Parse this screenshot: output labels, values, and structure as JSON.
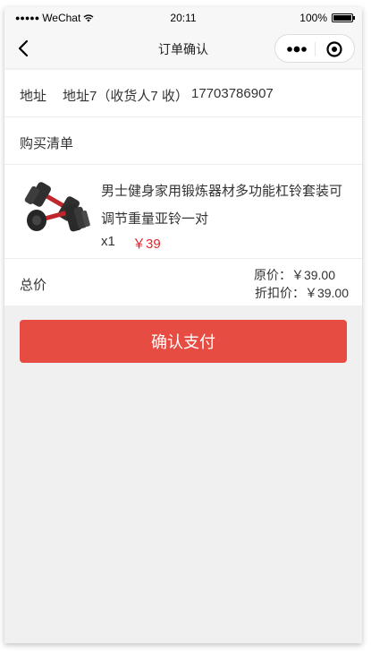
{
  "status_bar": {
    "signal": "●●●●●",
    "carrier": "WeChat",
    "time": "20:11",
    "battery": "100%"
  },
  "nav": {
    "title": "订单确认",
    "icons": [
      "back-arrow-icon",
      "more-dots-icon",
      "close-circle-icon"
    ]
  },
  "address": {
    "label": "地址",
    "text": "地址7（收货人7 收）",
    "phone": "17703786907"
  },
  "purchase_list": {
    "label": "购买清单"
  },
  "item": {
    "name": "男士健身家用锻炼器材多功能杠铃套装可调节重量亚铃一对",
    "quantity": "x1",
    "price": "￥39",
    "image": "dumbbell-product-image"
  },
  "total": {
    "label": "总价",
    "original_price": "原价：￥39.00",
    "discount_price": "折扣价：￥39.00"
  },
  "actions": {
    "pay_label": "确认支付"
  },
  "colors": {
    "accent": "#e64c42",
    "price_red": "#e0262b",
    "background": "#f0f0f0"
  }
}
